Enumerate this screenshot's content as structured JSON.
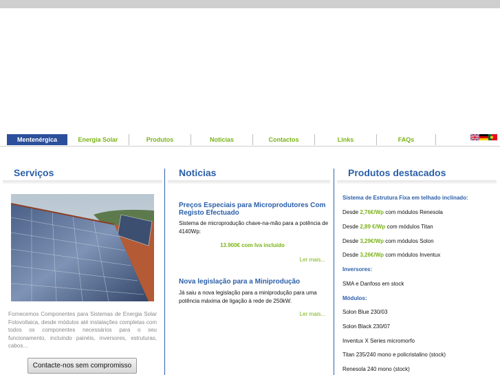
{
  "nav": {
    "items": [
      {
        "label": "Mentenérgica",
        "active": true
      },
      {
        "label": "Energia Solar",
        "active": false
      },
      {
        "label": "Produtos",
        "active": false
      },
      {
        "label": "Noticias",
        "active": false
      },
      {
        "label": "Contactos",
        "active": false
      },
      {
        "label": "Links",
        "active": false
      },
      {
        "label": "FAQs",
        "active": false
      }
    ],
    "flags": [
      "uk-flag-icon",
      "germany-flag-icon",
      "portugal-flag-icon"
    ]
  },
  "servicos": {
    "title": "Serviços",
    "description": "Fornecemos Componentes para Sistemas de Energia Solar Fotovoltaica, desde módulos até instalações completas com todos os componentes necessários para o seu funcionamento, incluindo painéis, inversores, estruturas, cabos…",
    "button_label": "Contacte-nos sem compromisso"
  },
  "noticias": {
    "title": "Noticias",
    "articles": [
      {
        "title": "Preços Especiais para Microprodutores Com Registo Efectuado",
        "text": "Sistema de microprodução chave-na-mão para a potência de 4140Wp:",
        "price": "13.900€ com Iva incluido",
        "more": "Ler mais..."
      },
      {
        "title": "Nova legislação para a Miniprodução",
        "text": "Já saiu a nova legislação para a miniprodução para uma potência máxima de ligação à rede de 250kW.",
        "more": "Ler mais..."
      }
    ]
  },
  "produtos": {
    "title": "Produtos destacados",
    "estrutura_heading": "Sistema de Estrutura Fixa em telhado inclinado:",
    "offers": [
      {
        "prefix": "Desde",
        "price": "2,76€/Wp",
        "suffix": "com módulos Renesola"
      },
      {
        "prefix": "Desde",
        "price": "2,89 €/Wp",
        "suffix": "com módulos Titan"
      },
      {
        "prefix": "Desde",
        "price": "3,29€/Wp",
        "suffix": "com módulos Solon"
      },
      {
        "prefix": "Desde",
        "price": "3,26€/Wp",
        "suffix": "com módulos Inventux"
      }
    ],
    "inversores_heading": "Inversores:",
    "inversores_text": "SMA e Danfoss em stock",
    "modulos_heading": "Módulos:",
    "modulos": [
      "Solon Blue 230/03",
      "Solon Black 230/07",
      "Inventux X Series micromorfo",
      "Titan 235/240 mono e policristalino (stock)",
      "Renesola 240 mono (stock)"
    ]
  },
  "colors": {
    "accent_blue": "#2b5fa8",
    "nav_active": "#2b4f9b",
    "accent_green": "#7ab317"
  }
}
